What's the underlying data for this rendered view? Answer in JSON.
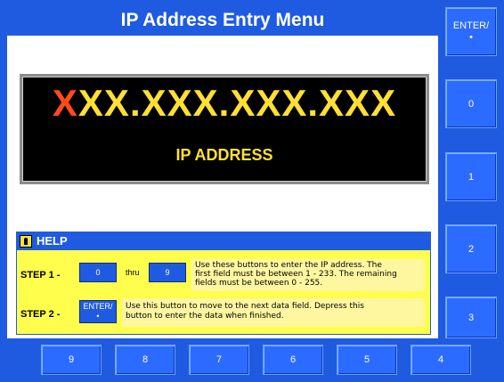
{
  "title": "IP Address Entry Menu",
  "display": {
    "ip_first_char": "X",
    "ip_rest": "XX.XXX.XXX.XXX",
    "label": "IP ADDRESS"
  },
  "help": {
    "title": "HELP",
    "step1": {
      "label": "STEP 1 -",
      "btn_a": "0",
      "thru": "thru",
      "btn_b": "9",
      "text_line1": "Use these buttons to enter the IP address.  The",
      "text_line2": "first field must be between 1 - 233.  The remaining",
      "text_line3": "fields must be between 0 - 255."
    },
    "step2": {
      "label": "STEP 2 -",
      "btn_top": "ENTER/",
      "btn_bottom": "•",
      "text_line1": "Use this button to move to the next data field.  Depress this",
      "text_line2": "button to enter the data when finished."
    }
  },
  "side_buttons": [
    {
      "top": "ENTER/",
      "bottom": "•"
    },
    {
      "label": "0"
    },
    {
      "label": "1"
    },
    {
      "label": "2"
    },
    {
      "label": "3"
    }
  ],
  "bottom_buttons": [
    "9",
    "8",
    "7",
    "6",
    "5",
    "4"
  ],
  "colors": {
    "frame_blue": "#1f5be0",
    "button_blue": "#2b6bff",
    "display_yellow": "#ffe033",
    "display_cursor_orange": "#ff4b1a",
    "help_yellow": "#fffe4c"
  }
}
